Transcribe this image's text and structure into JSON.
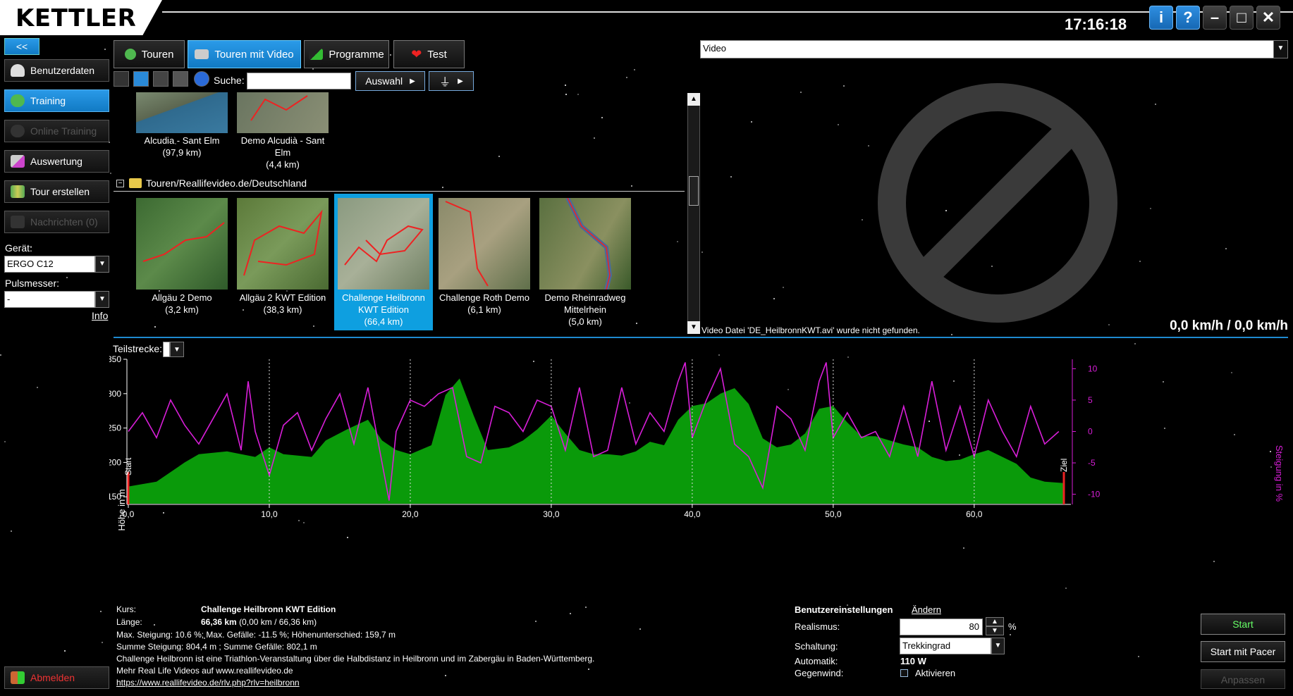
{
  "app": {
    "logo": "KETTLER",
    "clock": "17:16:18"
  },
  "window_buttons": {
    "info": "i",
    "help": "?",
    "minimize": "–",
    "maximize": "□",
    "close": "✕"
  },
  "sidebar": {
    "collapse": "<<",
    "items": [
      {
        "label": "Benutzerdaten",
        "state": "normal"
      },
      {
        "label": "Training",
        "state": "active"
      },
      {
        "label": "Online Training",
        "state": "disabled"
      },
      {
        "label": "Auswertung",
        "state": "normal"
      },
      {
        "label": "Tour erstellen",
        "state": "normal"
      },
      {
        "label": "Nachrichten (0)",
        "state": "disabled"
      }
    ],
    "device_label": "Gerät:",
    "device_value": "ERGO C12",
    "pulse_label": "Pulsmesser:",
    "pulse_value": "-",
    "info_link": "Info",
    "logout": "Abmelden"
  },
  "tabs": [
    {
      "label": "Touren",
      "active": false
    },
    {
      "label": "Touren mit Video",
      "active": true
    },
    {
      "label": "Programme",
      "active": false
    },
    {
      "label": "Test",
      "active": false
    }
  ],
  "toolbar": {
    "search_label": "Suche:",
    "search_value": "",
    "select_label": "Auswahl",
    "filter_arrow": "▸"
  },
  "tour_list": {
    "top_row": [
      {
        "name": "Alcudia - Sant Elm",
        "distance": "(97,9 km)"
      },
      {
        "name": "Demo Alcudià - Sant Elm",
        "distance": "(4,4 km)"
      }
    ],
    "group_path": "Touren/Reallifevideo.de/Deutschland",
    "group_row": [
      {
        "name": "Allgäu 2 Demo",
        "distance": "(3,2 km)",
        "selected": false
      },
      {
        "name": "Allgäu 2 KWT Edition",
        "distance": "(38,3 km)",
        "selected": false
      },
      {
        "name": "Challenge Heilbronn KWT Edition",
        "distance": "(66,4 km)",
        "selected": true
      },
      {
        "name": "Challenge Roth Demo",
        "distance": "(6,1 km)",
        "selected": false
      },
      {
        "name": "Demo Rheinradweg Mittelrhein",
        "distance": "(5,0 km)",
        "selected": false
      }
    ]
  },
  "video": {
    "source": "Video",
    "error": "Video Datei 'DE_HeilbronnKWT.avi' wurde nicht gefunden.",
    "speed": "0,0 km/h / 0,0 km/h"
  },
  "profile": {
    "segment_label": "Teilstrecke:",
    "start_label": "Start",
    "finish_label": "Ziel",
    "colors": {
      "elevation": "#0a9a0a",
      "gradient": "#d81ed8"
    }
  },
  "chart_data": {
    "type": "area",
    "xlabel": "",
    "ylabel": "Höhe in m",
    "y2label": "Steigung in %",
    "xlim": [
      0,
      66.36
    ],
    "ylim": [
      140,
      350
    ],
    "y2lim": [
      -11.5,
      11.5
    ],
    "x_ticks": [
      "0,0",
      "10,0",
      "20,0",
      "30,0",
      "40,0",
      "50,0",
      "60,0"
    ],
    "y_ticks": [
      "150",
      "200",
      "250",
      "300",
      "350"
    ],
    "y2_ticks": [
      "10",
      "5",
      "0",
      "-5",
      "-10"
    ],
    "series": [
      {
        "name": "",
        "type": "area",
        "axis": "left",
        "x": [
          0,
          2,
          4,
          5,
          7,
          9,
          10,
          11,
          13,
          14,
          15.5,
          17,
          18,
          19,
          20,
          21.5,
          22.5,
          23.5,
          24.5,
          25.5,
          27,
          28,
          29,
          30,
          31,
          32,
          33,
          34,
          35,
          36,
          37,
          38,
          39,
          40,
          41,
          42,
          43,
          44,
          45,
          46,
          47,
          48,
          49,
          50,
          51,
          52,
          53,
          54,
          55,
          56,
          57,
          58,
          59,
          60,
          61,
          62,
          63,
          64,
          65,
          66.36
        ],
        "y": [
          165,
          172,
          200,
          212,
          216,
          208,
          222,
          212,
          208,
          232,
          248,
          262,
          232,
          218,
          212,
          225,
          298,
          322,
          268,
          218,
          222,
          232,
          248,
          268,
          242,
          218,
          212,
          212,
          210,
          216,
          230,
          225,
          262,
          282,
          286,
          300,
          308,
          285,
          235,
          222,
          226,
          242,
          278,
          282,
          258,
          238,
          238,
          232,
          226,
          222,
          208,
          202,
          204,
          212,
          218,
          208,
          198,
          178,
          172,
          170
        ]
      },
      {
        "name": "",
        "type": "line",
        "axis": "right",
        "x": [
          0,
          1,
          2,
          3,
          4,
          5,
          6,
          7,
          8,
          8.5,
          9,
          10,
          11,
          12,
          13,
          14,
          15,
          16,
          17,
          18,
          18.5,
          19,
          20,
          21,
          22,
          23,
          24,
          25,
          26,
          27,
          28,
          29,
          30,
          31,
          32,
          33,
          34,
          35,
          36,
          37,
          38,
          39,
          39.5,
          40,
          41,
          42,
          43,
          44,
          45,
          46,
          47,
          48,
          49,
          49.5,
          50,
          51,
          52,
          53,
          54,
          55,
          56,
          57,
          58,
          59,
          60,
          61,
          62,
          63,
          64,
          65,
          66
        ],
        "y": [
          0,
          3,
          -1,
          5,
          1,
          -2,
          2,
          6,
          -3,
          8,
          0,
          -7,
          1,
          3,
          -3,
          2,
          6,
          -2,
          7,
          -5,
          -11,
          0,
          5,
          4,
          6,
          7,
          -4,
          -5,
          4,
          3,
          0,
          5,
          4,
          -3,
          7,
          -4,
          -3,
          7,
          -2,
          3,
          0,
          8,
          11,
          -1,
          5,
          10,
          -2,
          -4,
          -9,
          4,
          2,
          -3,
          8,
          11,
          -1,
          3,
          -1,
          0,
          -4,
          4,
          -4,
          8,
          -3,
          4,
          -4,
          5,
          0,
          -4,
          4,
          -2,
          0
        ]
      }
    ]
  },
  "course": {
    "course_label": "Kurs:",
    "course_value": "Challenge Heilbronn KWT Edition",
    "length_label": "Länge:",
    "length_value": "66,36 km",
    "length_detail": "(0,00 km / 66,36 km)",
    "stats1": "Max. Steigung: 10.6 %; Max. Gefälle: -11.5 %; Höhenunterschied: 159,7 m",
    "stats2": "Summe Steigung: 804,4 m ; Summe Gefälle: 802,1 m",
    "description": "Challenge Heilbronn ist eine Triathlon-Veranstaltung über die Halbdistanz in Heilbronn und im Zabergäu in Baden-Württemberg.",
    "more": "Mehr Real Life Videos auf www.reallifevideo.de",
    "url": "https://www.reallifevideo.de/rlv.php?rlv=heilbronn"
  },
  "settings": {
    "title": "Benutzereinstellungen",
    "change_link": "Ändern",
    "realism_label": "Realismus:",
    "realism_value": "80",
    "realism_unit": "%",
    "shift_label": "Schaltung:",
    "shift_value": "Trekkingrad",
    "auto_label": "Automatik:",
    "auto_value": "110 W",
    "wind_label": "Gegenwind:",
    "wind_checkbox": "Aktivieren"
  },
  "actions": {
    "start": "Start",
    "start_pacer": "Start mit Pacer",
    "adjust": "Anpassen"
  }
}
